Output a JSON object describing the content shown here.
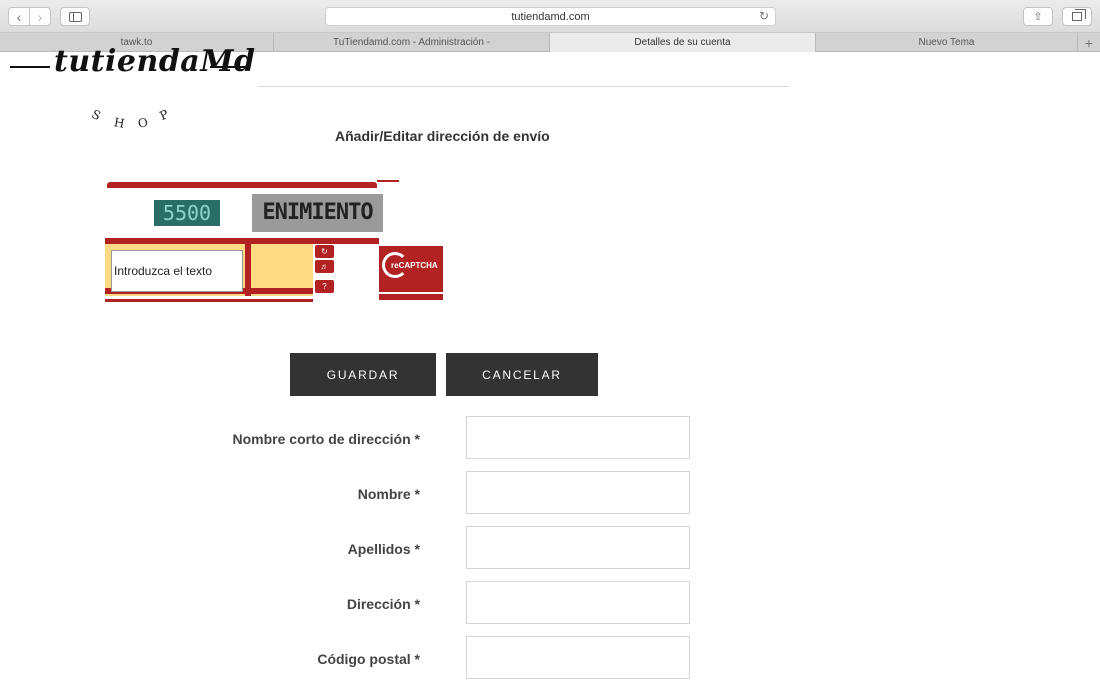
{
  "browser": {
    "url": "tutiendamd.com",
    "tabs": [
      {
        "label": "tawk.to",
        "active": false
      },
      {
        "label": "TuTiendamd.com - Administración -",
        "active": false
      },
      {
        "label": "Detalles de su cuenta",
        "active": true
      },
      {
        "label": "Nuevo Tema",
        "active": false
      }
    ],
    "icons": [
      "chevron-left-icon",
      "chevron-right-icon",
      "sidebar-icon",
      "reload-icon",
      "share-icon",
      "tabs-overview-icon",
      "plus-icon"
    ]
  },
  "logo": {
    "text": "tutiendaMd",
    "shop_letters": [
      "S",
      "H",
      "O",
      "P"
    ]
  },
  "page": {
    "heading": "Añadir/Editar dirección de envío"
  },
  "captcha": {
    "word1": "5500",
    "word2": "ENIMIENTO",
    "input_placeholder": "Introduzca el texto",
    "brand": "reCAPTCHA",
    "colors": {
      "frame": "#b22222",
      "panel": "#fdda83"
    }
  },
  "actions": {
    "save_label": "GUARDAR",
    "cancel_label": "CANCELAR"
  },
  "form": {
    "fields": [
      {
        "label": "Nombre corto de dirección *",
        "value": ""
      },
      {
        "label": "Nombre *",
        "value": ""
      },
      {
        "label": "Apellidos *",
        "value": ""
      },
      {
        "label": "Dirección *",
        "value": ""
      },
      {
        "label": "Código postal *",
        "value": ""
      }
    ]
  }
}
